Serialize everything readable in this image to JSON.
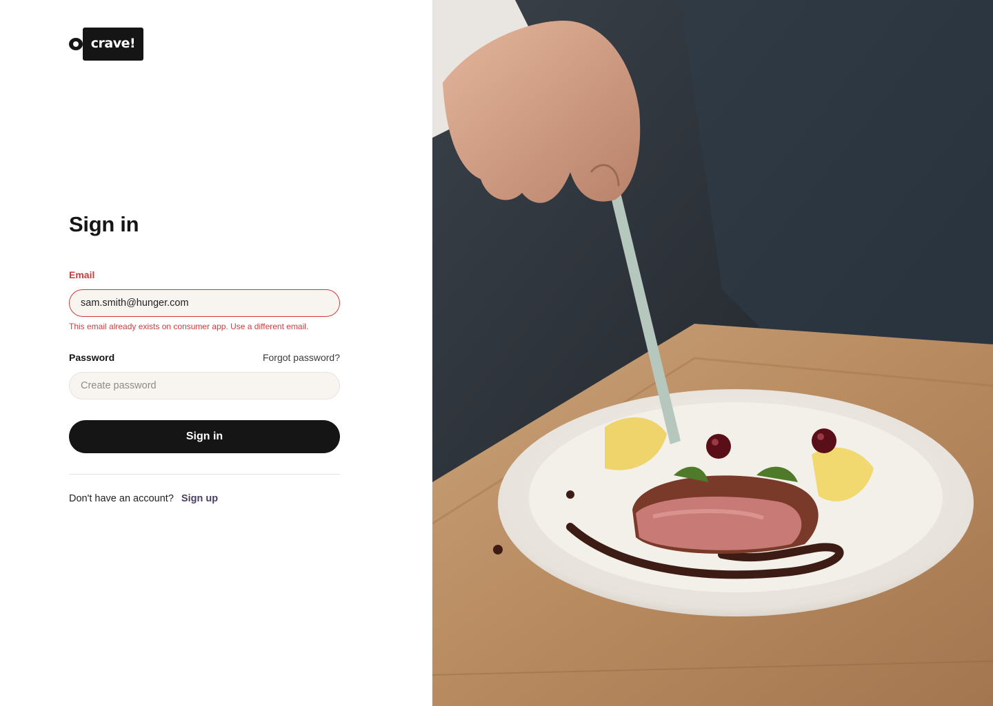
{
  "brand": {
    "logo_text": "crave!"
  },
  "form": {
    "title": "Sign in",
    "email": {
      "label": "Email",
      "value": "sam.smith@hunger.com",
      "error": "This email already exists on consumer app. Use a different email."
    },
    "password": {
      "label": "Password",
      "placeholder": "Create password",
      "forgot_link": "Forgot password?"
    },
    "submit_label": "Sign in",
    "signup_prompt": "Don't have an account?",
    "signup_link": "Sign up"
  },
  "colors": {
    "error": "#d13a3a",
    "primary_button": "#151515",
    "input_background": "#f8f5f1",
    "link": "#4a3f5e"
  },
  "hero_image": {
    "icon": "chef-plating-dish-photo"
  }
}
